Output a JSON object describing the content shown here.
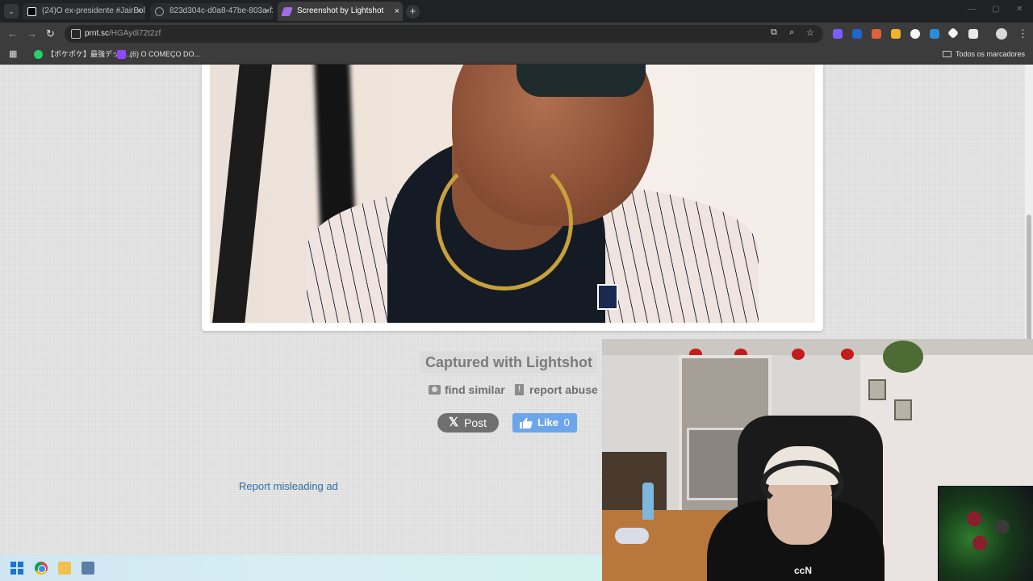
{
  "browser": {
    "tabs": [
      {
        "title": "(24)O ex-presidente #JairBolso",
        "active": false,
        "favicon_color": "#ffffff"
      },
      {
        "title": "823d304c-d0a8-47be-803a-f2",
        "active": false,
        "favicon_color": "#9aa0a6"
      },
      {
        "title": "Screenshot by Lightshot",
        "active": true,
        "favicon_color": "#a16ce6"
      }
    ],
    "tab_close_glyph": "×",
    "new_tab_glyph": "+",
    "url_domain": "prnt.sc",
    "url_path": "/HGAydi72t2zf",
    "bookmarks": [
      {
        "label": "【ポケポケ】最強デッキ...",
        "icon_color": "#25d366"
      },
      {
        "label": "(6) O COMEÇO DO...",
        "icon_color": "#9146ff"
      }
    ],
    "bookmarks_folder": "Todos os marcadores",
    "extension_colors": [
      "#7b5cff",
      "#1e66d0",
      "#e0613a",
      "#f0b429",
      "#f5f5f5",
      "#2b8cd8",
      "#f5f5f5",
      "#e8e8e8"
    ]
  },
  "page": {
    "captured_text": "Captured with Lightshot",
    "find_similar": "find similar",
    "report_abuse": "report abuse",
    "x_post": "Post",
    "fb_like": "Like",
    "fb_count": "0",
    "report_misleading_ad": "Report misleading ad"
  },
  "webcam": {
    "shirt_logo": "ccN"
  },
  "colors": {
    "accent_link": "#2a6fa8",
    "fb_blue": "#6da5ec",
    "x_gray": "#6f6f6f"
  }
}
